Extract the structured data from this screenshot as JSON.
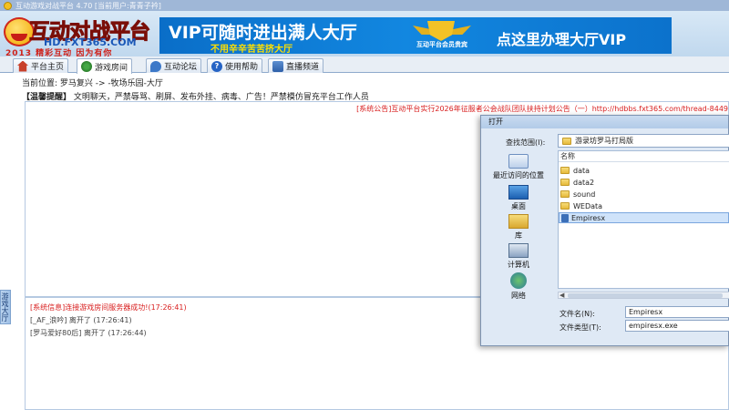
{
  "window": {
    "title": "互动游戏对战平台 4.70 [当前用户:青青子衿]"
  },
  "banner": {
    "logo_main": "互动对战平台",
    "logo_sub": "HD.FXT365.COM",
    "logo_slogan": "2013 精彩互动 因为有你",
    "ad1_main": "VIP可随时进出满人大厅",
    "ad1_sub": "不用辛辛苦苦挤大厅",
    "ad2_badge": "互动平台会员贵宾",
    "ad2_main": "点这里办理大厅VIP"
  },
  "tabs": [
    {
      "label": "平台主页",
      "icon": "home-icon"
    },
    {
      "label": "游戏房间",
      "icon": "game-room-icon"
    },
    {
      "label": "互动论坛",
      "icon": "forum-icon"
    },
    {
      "label": "使用帮助",
      "icon": "help-icon"
    },
    {
      "label": "直播频道",
      "icon": "live-channel-icon"
    }
  ],
  "location": {
    "text": "当前位置: 罗马复兴 -> -牧场乐园-大厅"
  },
  "reminder": {
    "tag": "【温馨提醒】",
    "text": "文明聊天，严禁辱骂、刷屏、发布外挂、病毒、广告！严禁模仿冒充平台工作人员"
  },
  "side_tab": {
    "label": "游戏大厅"
  },
  "announcement": {
    "text": "[系统公告]互动平台实行2026年征服者公会战队团队扶持计划公告（一）http://hdbbs.fxt365.com/thread-8449"
  },
  "messages": [
    {
      "text": "[系统信息]连接游戏房间服务器成功!(17:26:41)"
    },
    {
      "text": "[_AF_浪吟] 离开了 (17:26:41)"
    },
    {
      "text": "[罗马爱好80后] 离开了 (17:26:44)"
    }
  ],
  "dialog": {
    "title": "打开",
    "lookin_label": "查找范围(I):",
    "lookin_value": "游录坊罗马打局版",
    "places": [
      {
        "label": "最近访问的位置",
        "icon": "recent-places-icon"
      },
      {
        "label": "桌面",
        "icon": "desktop-icon"
      },
      {
        "label": "库",
        "icon": "libraries-icon"
      },
      {
        "label": "计算机",
        "icon": "computer-icon"
      },
      {
        "label": "网络",
        "icon": "network-icon"
      }
    ],
    "column_name": "名称",
    "files": [
      {
        "name": "data",
        "type": "folder"
      },
      {
        "name": "data2",
        "type": "folder"
      },
      {
        "name": "sound",
        "type": "folder"
      },
      {
        "name": "WEData",
        "type": "folder"
      },
      {
        "name": "Empiresx",
        "type": "exe"
      }
    ],
    "filename_label": "文件名(N):",
    "filename_value": "Empiresx",
    "filetype_label": "文件类型(T):",
    "filetype_value": "empiresx.exe"
  },
  "colors": {
    "accent_blue": "#1287e0",
    "announce_red": "#d81e1e",
    "logo_red": "#e8241a"
  }
}
